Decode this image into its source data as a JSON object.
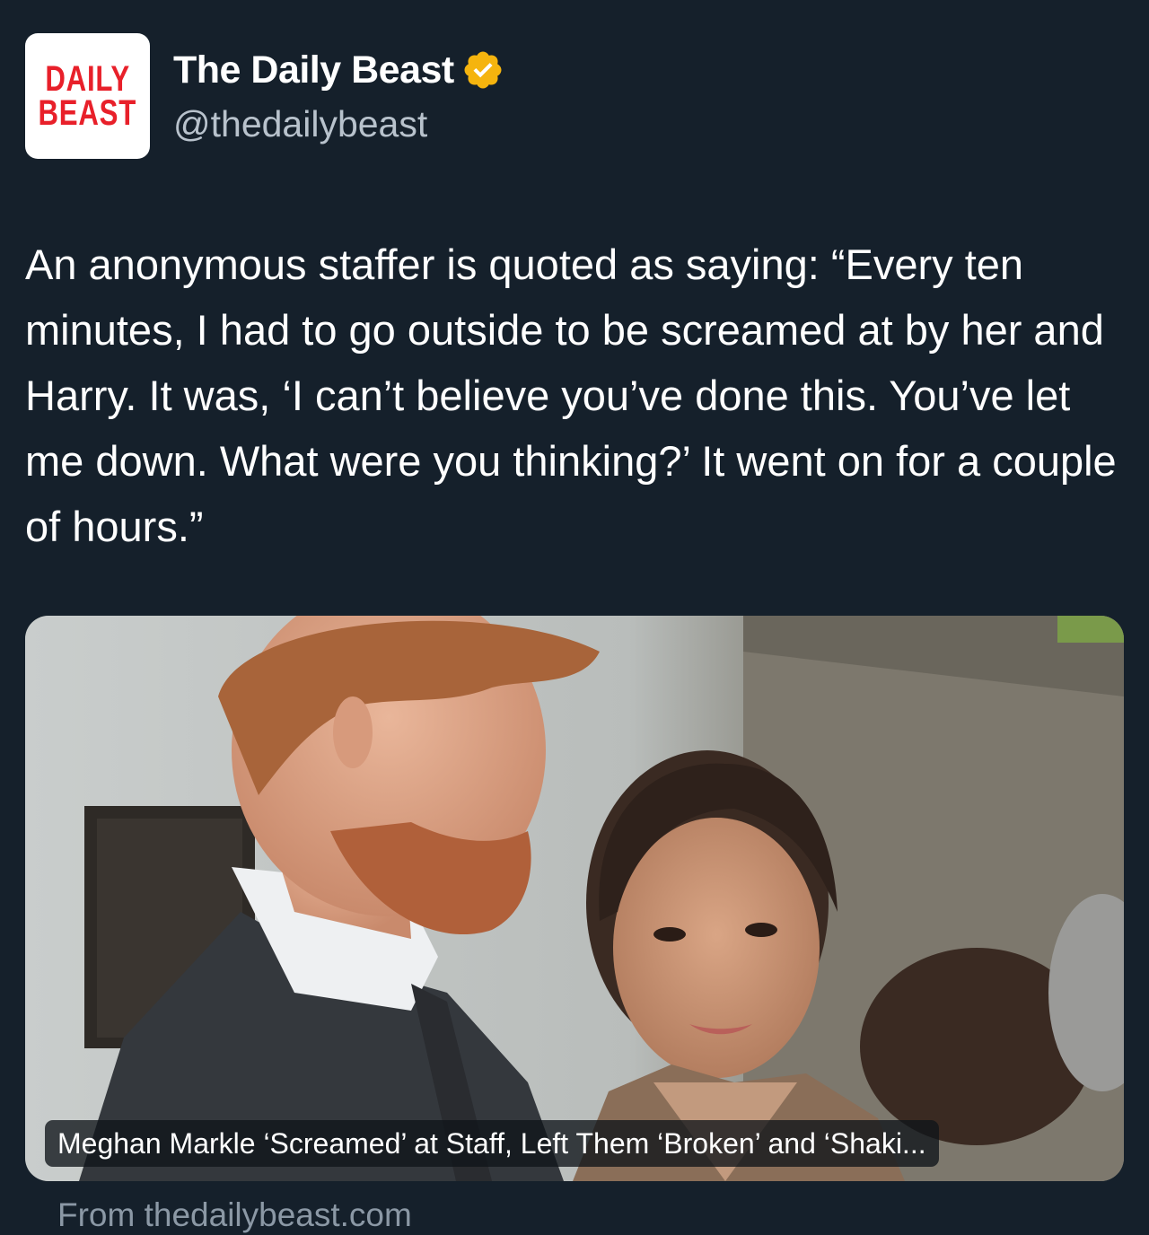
{
  "account": {
    "avatar_logo_lines": [
      "DAILY",
      "BEAST"
    ],
    "display_name": "The Daily Beast",
    "handle": "@thedailybeast",
    "verified": true,
    "verified_badge_color": "#f5b40e"
  },
  "tweet": {
    "text": "An anonymous staffer is quoted as saying: “Every ten minutes, I had to go outside to be screamed at by her and Harry. It was, ‘I can’t believe you’ve done this. You’ve let me down. What were you thinking?’ It went on for a couple of hours.”"
  },
  "link_card": {
    "headline": "Meghan Markle ‘Screamed’ at Staff, Left Them ‘Broken’ and ‘Shaki...",
    "source_label": "From thedailybeast.com"
  },
  "colors": {
    "background": "#15202b",
    "brand_red": "#e8202a"
  }
}
